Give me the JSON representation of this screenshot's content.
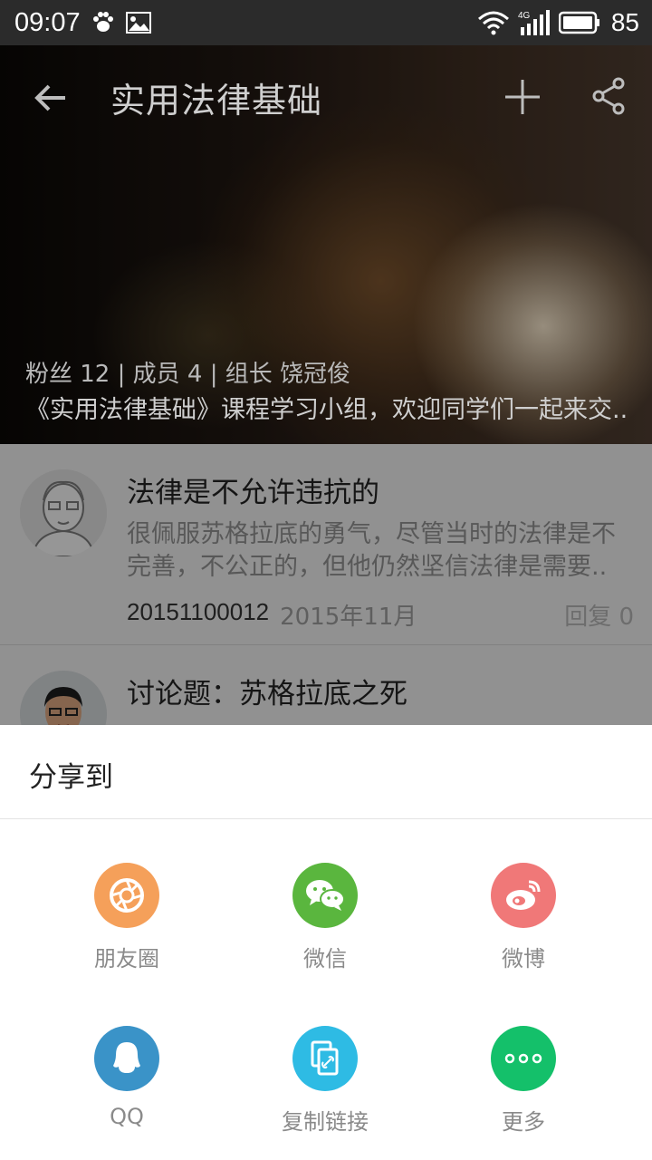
{
  "status_bar": {
    "time": "09:07",
    "battery": "85",
    "network": "4G"
  },
  "header": {
    "title": "实用法律基础"
  },
  "group": {
    "meta": "粉丝 12 | 成员 4 | 组长 饶冠俊",
    "description": "《实用法律基础》课程学习小组，欢迎同学们一起来交.."
  },
  "posts": [
    {
      "title": "法律是不允许违抗的",
      "excerpt_line1": "很佩服苏格拉底的勇气，尽管当时的法律是不",
      "excerpt_line2": "完善，不公正的，但他仍然坚信法律是需要..",
      "author": "20151100012",
      "date": "2015年11月",
      "reply": "回复 0"
    },
    {
      "title": "讨论题：苏格拉底之死"
    }
  ],
  "share_sheet": {
    "title": "分享到",
    "items": [
      {
        "label": "朋友圈",
        "icon": "moments-icon",
        "color": "#f5a05a"
      },
      {
        "label": "微信",
        "icon": "wechat-icon",
        "color": "#5ab63e"
      },
      {
        "label": "微博",
        "icon": "weibo-icon",
        "color": "#f07878"
      },
      {
        "label": "QQ",
        "icon": "qq-icon",
        "color": "#3a93c8"
      },
      {
        "label": "复制链接",
        "icon": "copy-link-icon",
        "color": "#2ebbe4"
      },
      {
        "label": "更多",
        "icon": "more-icon",
        "color": "#14c06a"
      }
    ]
  }
}
